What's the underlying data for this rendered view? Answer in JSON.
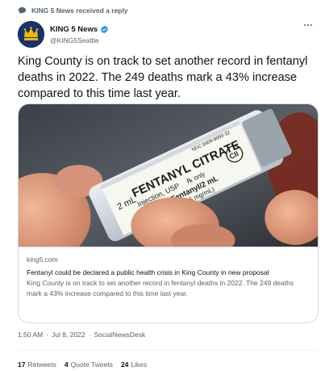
{
  "reply_notice": {
    "text": "KING 5 News received a reply",
    "icon": "comment-icon"
  },
  "author": {
    "display_name": "KING 5 News",
    "handle": "@KING5Seattle",
    "verified": true,
    "verified_color": "#1d9bf0",
    "avatar_bg": "#15326b",
    "avatar_icon": "king5-crown-logo"
  },
  "tweet": {
    "text": "King County is on track to set another record in fentanyl deaths in 2022. The 249 deaths mark a 43% increase compared to this time last year."
  },
  "card": {
    "vial_label": {
      "ndc": "NDC 0409-9093-32",
      "volume": "2 mL",
      "drug": "FENTANYL CITRATE",
      "route": "Injection, USP",
      "rx": "℞ only",
      "schedule": "CII",
      "dose_line1": "100 mcg Fentanyl/2 mL",
      "dose_line2": "(50 mcg/mL) (0.05 mg/mL)"
    },
    "domain": "king5.com",
    "title": "Fentanyl could be declared a public health crisis in King County in new proposal",
    "description": "King County is on track to set another record in fentanyl deaths in 2022. The 249 deaths mark a 43% increase compared to this time last year."
  },
  "meta": {
    "time": "1:50 AM",
    "separator": "·",
    "date": "Jul 8, 2022",
    "source": "SocialNewsDesk"
  },
  "stats": [
    {
      "count": "17",
      "label": "Retweets"
    },
    {
      "count": "4",
      "label": "Quote Tweets"
    },
    {
      "count": "24",
      "label": "Likes"
    }
  ]
}
